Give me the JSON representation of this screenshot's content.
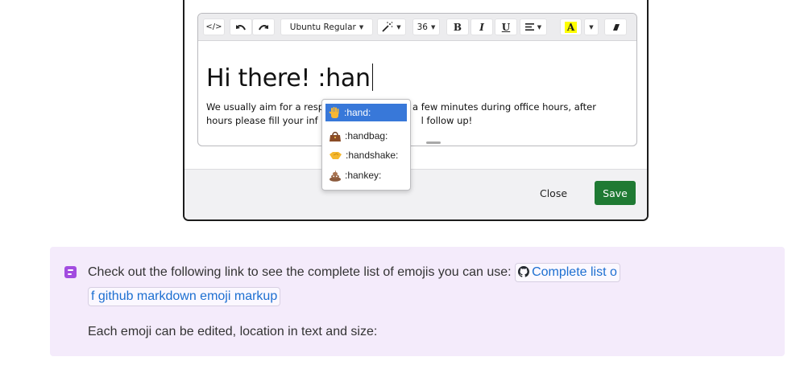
{
  "editor": {
    "toolbar": {
      "font_family": "Ubuntu Regular",
      "font_size": "36",
      "bold": "B",
      "italic": "I",
      "underline": "U",
      "text_color": "A",
      "highlight_color": "#ffff00",
      "icons": [
        "code-view-icon",
        "undo-icon",
        "redo-icon",
        "magic-wand-icon",
        "align-icon",
        "eraser-icon"
      ]
    },
    "headline": "Hi there! :han",
    "paragraph_line1_a": "We usually aim for a resp",
    "paragraph_line1_b": "a few minutes during office hours, after",
    "paragraph_line2_a": "hours please fill your inf",
    "paragraph_line2_b": "l follow up!"
  },
  "emoji_suggestions": [
    {
      "code": ":hand:",
      "icon": "raised-hand-icon",
      "active": true
    },
    {
      "code": ":handbag:",
      "icon": "handbag-icon",
      "active": false
    },
    {
      "code": ":handshake:",
      "icon": "handshake-icon",
      "active": false
    },
    {
      "code": ":hankey:",
      "icon": "pile-of-poo-icon",
      "active": false
    }
  ],
  "modal": {
    "close_label": "Close",
    "save_label": "Save",
    "save_color": "#1f7a33"
  },
  "callout": {
    "text": "Check out the following link to see the complete list of emojis you can use:",
    "link_text_1": "Complete list o",
    "link_text_2": "f github markdown emoji markup",
    "link_icon": "github-icon",
    "text2": "Each emoji can be edited, location in text and size:",
    "accent_color": "#a24ce0",
    "background": "#f4ebfb"
  }
}
